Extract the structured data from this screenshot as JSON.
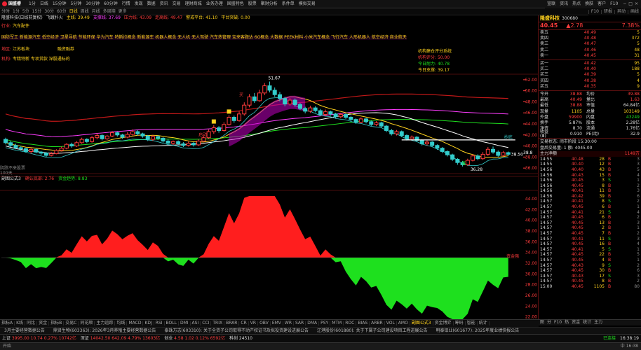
{
  "app": {
    "logo_label": "国盛睿",
    "menu": [
      "1分",
      "日线",
      "15分钟",
      "5分钟",
      "30分钟",
      "60分钟",
      "行情",
      "发现",
      "数据",
      "资讯",
      "交易",
      "理财商城",
      "业务办理",
      "国盛特色",
      "股票",
      "聚财分析",
      "条件单",
      "模拟交易"
    ],
    "right_buttons": [
      "宣联",
      "资讯",
      "热点",
      "换肤",
      "客户",
      "F10"
    ],
    "win_controls": [
      "−",
      "□",
      "×"
    ]
  },
  "periodbar": {
    "periods": [
      "分时",
      "1分",
      "5分",
      "15分",
      "30分",
      "60分",
      "日线",
      "周线",
      "月线",
      "多周期",
      "更多"
    ],
    "active_period": "日线",
    "right_tools": [
      "F10",
      "研报",
      "异动",
      "画线"
    ]
  },
  "main": {
    "stock_name": "隆盛科技",
    "legend_line1": [
      {
        "text": "隆盛科技(日线前复权)",
        "color": "#dddddd"
      },
      {
        "text": "飞蛾扑火",
        "color": "#dddddd"
      },
      {
        "text": "主线: 39.49",
        "color": "#ffd21e"
      },
      {
        "text": "支撑线: 37.69",
        "color": "#ff3cff"
      },
      {
        "text": "压力线: 43.09",
        "color": "#ff3c3c"
      },
      {
        "text": "走高线: 49.47",
        "color": "#ff3c3c"
      },
      {
        "text": "警戒平台: 41.10",
        "color": "#ffd21e"
      },
      {
        "text": "平台突破: 0.00",
        "color": "#ffd21e"
      }
    ],
    "concept_label": "行业:",
    "concept_value": "汽车配件",
    "concept_line": "国防军工 新能源汽车 低空经济 卫星导航 节能环保 华为汽车 特斯拉概念 新能源车 机器人概念 无人机 无人驾驶 汽车热管理 宝来客题达 6G概念 大数据 PEEK材料 小米汽车概念 飞行汽车 人形机器人 航空经济 商业航天",
    "region_label": "地区:",
    "region_value": "江苏板块",
    "financing_label": "融资融券",
    "main_biz_label": "机构:",
    "main_biz": "专精特新 专项贷款 深股通标的",
    "score_box": {
      "title": "机构建仓评分系统",
      "items": [
        {
          "label": "机构评分: ",
          "value": "50.00",
          "color": "#ff3c3c"
        },
        {
          "label": "今日耐力: ",
          "value": "40.78",
          "color": "#1ee01e"
        },
        {
          "label": "今日支撑: ",
          "value": "39.17",
          "color": "#ffd21e"
        }
      ]
    },
    "marks": {
      "high": "51.67",
      "low": "36.28",
      "last": "38.50",
      "right_tag": "38.8",
      "lbl_buy": "买",
      "lbl_start": "启动",
      "lbl_bottom": "底",
      "lbl_cb": "抄底"
    },
    "volume_caption": "阴跌不来股票",
    "volume_sub": "100天",
    "y_ticks_main": [
      "52.00",
      "50.00",
      "48.00",
      "46.00",
      "44.00",
      "42.00",
      "40.00",
      "38.00",
      "36.00"
    ],
    "y_ticks_sub": [
      "44.00",
      "42.00",
      "40.00",
      "38.00",
      "36.00",
      "34.00",
      "32.00",
      "30.00",
      "28.00",
      "26.00",
      "24.00",
      "22.00",
      "20.00"
    ],
    "date_ticks": [
      {
        "label": "2025年",
        "x": 2
      },
      {
        "label": "12",
        "x": 118
      },
      {
        "label": "2",
        "x": 286
      },
      {
        "label": "3",
        "x": 450
      },
      {
        "label": "4",
        "x": 690
      }
    ]
  },
  "sub": {
    "title": "副图公式3",
    "legend": [
      {
        "text": "确认底部: 2.76",
        "color": "#ff3c3c"
      },
      {
        "text": "资金趋势: 8.83",
        "color": "#1ee01e"
      }
    ],
    "peak_label": "资金强"
  },
  "chart_data": {
    "type": "candlestick",
    "title": "隆盛科技(日线前复权)",
    "ylim": [
      35,
      53
    ],
    "candles": [
      [
        41.2,
        40.6,
        41.5,
        40.3
      ],
      [
        40.6,
        40.1,
        40.9,
        39.8
      ],
      [
        40.1,
        39.7,
        40.4,
        39.4
      ],
      [
        39.7,
        39.5,
        40.0,
        39.2
      ],
      [
        39.5,
        39.0,
        39.7,
        38.8
      ],
      [
        39.0,
        39.4,
        39.6,
        38.6
      ],
      [
        39.4,
        38.9,
        39.5,
        38.7
      ],
      [
        38.9,
        38.7,
        39.1,
        38.4
      ],
      [
        38.7,
        38.3,
        38.9,
        38.0
      ],
      [
        38.3,
        38.6,
        38.9,
        38.1
      ],
      [
        38.6,
        39.2,
        39.4,
        38.5
      ],
      [
        39.2,
        39.6,
        39.9,
        39.0
      ],
      [
        39.6,
        40.3,
        40.5,
        39.4
      ],
      [
        40.3,
        40.0,
        40.6,
        39.7
      ],
      [
        40.0,
        40.6,
        40.9,
        39.8
      ],
      [
        40.6,
        41.2,
        41.5,
        40.4
      ],
      [
        41.2,
        40.8,
        41.4,
        40.5
      ],
      [
        40.8,
        41.5,
        41.8,
        40.6
      ],
      [
        41.5,
        41.9,
        42.3,
        41.2
      ],
      [
        41.9,
        41.3,
        42.1,
        41.0
      ],
      [
        41.3,
        41.8,
        42.0,
        41.1
      ],
      [
        41.8,
        42.4,
        42.7,
        41.6
      ],
      [
        42.4,
        42.0,
        42.6,
        41.7
      ],
      [
        42.0,
        41.6,
        42.2,
        41.3
      ],
      [
        41.6,
        42.1,
        42.5,
        41.4
      ],
      [
        42.1,
        42.6,
        43.0,
        41.9
      ],
      [
        42.6,
        42.2,
        42.9,
        41.9
      ],
      [
        42.2,
        41.8,
        42.4,
        41.5
      ],
      [
        41.8,
        41.2,
        42.0,
        40.9
      ],
      [
        41.2,
        41.7,
        42.0,
        40.9
      ],
      [
        41.7,
        41.4,
        41.9,
        41.1
      ],
      [
        41.4,
        40.9,
        41.6,
        40.6
      ],
      [
        40.9,
        40.5,
        41.2,
        40.2
      ],
      [
        40.5,
        40.8,
        41.0,
        40.2
      ],
      [
        40.8,
        40.4,
        41.0,
        40.1
      ],
      [
        40.4,
        40.1,
        40.7,
        39.8
      ],
      [
        40.1,
        40.5,
        40.8,
        39.9
      ],
      [
        40.5,
        40.2,
        40.7,
        39.9
      ],
      [
        40.2,
        40.9,
        41.2,
        40.0
      ],
      [
        40.9,
        41.5,
        41.8,
        40.7
      ],
      [
        41.5,
        42.6,
        43.0,
        41.3
      ],
      [
        42.6,
        43.3,
        43.8,
        42.2
      ],
      [
        43.3,
        42.8,
        43.6,
        42.4
      ],
      [
        42.8,
        43.9,
        44.3,
        42.6
      ],
      [
        43.9,
        45.2,
        45.6,
        43.7
      ],
      [
        45.2,
        44.6,
        45.5,
        44.2
      ],
      [
        44.6,
        45.8,
        46.3,
        44.4
      ],
      [
        45.8,
        47.4,
        47.9,
        45.5
      ],
      [
        47.4,
        48.9,
        49.4,
        47.0
      ],
      [
        48.9,
        48.2,
        49.6,
        47.8
      ],
      [
        48.2,
        49.6,
        50.2,
        48.0
      ],
      [
        49.6,
        50.9,
        51.4,
        49.2
      ],
      [
        50.9,
        50.1,
        51.67,
        49.7
      ],
      [
        50.1,
        49.3,
        50.6,
        48.9
      ],
      [
        49.3,
        48.6,
        49.8,
        48.1
      ],
      [
        48.6,
        47.6,
        48.9,
        47.2
      ],
      [
        47.6,
        48.3,
        48.7,
        47.3
      ],
      [
        48.3,
        47.5,
        48.6,
        47.1
      ],
      [
        47.5,
        46.8,
        47.8,
        46.5
      ],
      [
        46.8,
        46.3,
        47.1,
        45.9
      ],
      [
        46.3,
        46.9,
        47.3,
        46.0
      ],
      [
        46.9,
        46.4,
        47.2,
        46.1
      ],
      [
        46.4,
        45.7,
        46.7,
        45.4
      ],
      [
        45.7,
        46.2,
        46.6,
        45.4
      ],
      [
        46.2,
        45.8,
        46.4,
        45.5
      ],
      [
        45.8,
        45.3,
        46.0,
        45.0
      ],
      [
        45.3,
        45.7,
        46.0,
        45.0
      ],
      [
        45.7,
        45.2,
        45.9,
        44.9
      ],
      [
        45.2,
        44.8,
        45.5,
        44.5
      ],
      [
        44.8,
        44.3,
        45.0,
        44.0
      ],
      [
        44.3,
        44.9,
        45.2,
        44.1
      ],
      [
        44.9,
        44.4,
        45.1,
        44.1
      ],
      [
        44.4,
        43.9,
        44.6,
        43.6
      ],
      [
        43.9,
        44.2,
        44.5,
        43.6
      ],
      [
        44.2,
        43.6,
        44.4,
        43.3
      ],
      [
        43.6,
        42.8,
        43.8,
        42.5
      ],
      [
        42.8,
        42.2,
        43.1,
        41.9
      ],
      [
        42.2,
        42.6,
        42.9,
        41.9
      ],
      [
        42.6,
        41.9,
        42.8,
        41.6
      ],
      [
        41.9,
        41.3,
        42.1,
        41.0
      ],
      [
        41.3,
        41.6,
        41.9,
        41.0
      ],
      [
        41.6,
        41.0,
        41.8,
        40.7
      ],
      [
        41.0,
        40.4,
        41.2,
        40.1
      ],
      [
        40.4,
        40.7,
        41.0,
        40.1
      ],
      [
        40.7,
        40.1,
        40.9,
        39.8
      ],
      [
        40.1,
        39.6,
        40.3,
        39.3
      ],
      [
        39.6,
        39.0,
        39.8,
        38.7
      ],
      [
        39.0,
        38.4,
        39.2,
        38.1
      ],
      [
        38.4,
        37.6,
        38.6,
        37.3
      ],
      [
        37.6,
        37.0,
        37.8,
        36.6
      ],
      [
        37.0,
        36.6,
        37.3,
        36.28
      ],
      [
        36.6,
        37.4,
        37.7,
        36.4
      ],
      [
        37.4,
        38.2,
        38.5,
        37.2
      ],
      [
        38.2,
        37.7,
        38.5,
        37.4
      ],
      [
        37.7,
        38.5,
        38.9,
        37.5
      ],
      [
        38.5,
        39.4,
        39.8,
        38.2
      ],
      [
        39.4,
        38.9,
        39.9,
        38.6
      ],
      [
        38.9,
        38.3,
        39.2,
        38.0
      ],
      [
        38.3,
        38.8,
        39.1,
        38.0
      ],
      [
        38.8,
        38.5,
        39.0,
        38.2
      ]
    ],
    "series": [
      {
        "name": "主线",
        "values": []
      },
      {
        "name": "支撑线",
        "values": []
      },
      {
        "name": "压力线",
        "values": []
      }
    ]
  },
  "side": {
    "name": "隆盛科技",
    "code": "300680",
    "price": "40.45",
    "change": "▲2.78",
    "pct": "7.38%",
    "asks": [
      {
        "l": "卖五",
        "p": "40.49",
        "v": "5"
      },
      {
        "l": "卖四",
        "p": "40.48",
        "v": "372"
      },
      {
        "l": "卖三",
        "p": "40.47",
        "v": "5"
      },
      {
        "l": "卖二",
        "p": "40.46",
        "v": "48"
      },
      {
        "l": "卖一",
        "p": "40.45",
        "v": "31"
      }
    ],
    "bids": [
      {
        "l": "买一",
        "p": "40.42",
        "v": "95"
      },
      {
        "l": "买二",
        "p": "40.40",
        "v": "188"
      },
      {
        "l": "买三",
        "p": "40.39",
        "v": "5"
      },
      {
        "l": "买四",
        "p": "40.38",
        "v": "4"
      },
      {
        "l": "买五",
        "p": "40.35",
        "v": "9"
      }
    ],
    "stats": [
      {
        "k": "今开",
        "v": "38.88",
        "vc": "#ff3c3c",
        "k2": "均价",
        "v2": "39.88",
        "v2c": "#ff3c3c"
      },
      {
        "k": "最高",
        "v": "40.49",
        "vc": "#ff3c3c",
        "k2": "量比",
        "v2": "1.63",
        "v2c": "#ff3c3c"
      },
      {
        "k": "最低",
        "v": "38.88",
        "vc": "#ff3c3c",
        "k2": "市值",
        "v2": "64.84亿",
        "v2c": "#dddddd"
      },
      {
        "k": "现量",
        "v": "1105",
        "vc": "#ffd21e",
        "k2": "总量",
        "v2": "103149",
        "v2c": "#ffd21e"
      },
      {
        "k": "外盘",
        "v": "59900",
        "vc": "#ff3c3c",
        "k2": "内盘",
        "v2": "43249",
        "v2c": "#1ee01e"
      },
      {
        "k": "换手",
        "v": "5.87%",
        "vc": "#dddddd",
        "k2": "股本",
        "v2": "2.28亿",
        "v2c": "#dddddd"
      },
      {
        "k": "净资",
        "v": "8.70",
        "vc": "#dddddd",
        "k2": "流通",
        "v2": "1.76亿",
        "v2c": "#dddddd"
      },
      {
        "k": "收益(Ⅲ)",
        "v": "0.910",
        "vc": "#dddddd",
        "k2": "PE(动)",
        "v2": "32.9",
        "v2c": "#dddddd"
      }
    ],
    "trade_status": "交易状态: 闭市阶段 15:30:00",
    "after_volume": "盘后交易量: 1 额: 4045.00",
    "main_flow_label": "主力净额",
    "main_flow_value": "1149万",
    "ticks": [
      {
        "t": "14:55",
        "p": "40.48",
        "q": "28",
        "s": "B",
        "n": "3"
      },
      {
        "t": "14:55",
        "p": "40.40",
        "q": "12",
        "s": "B",
        "n": "3"
      },
      {
        "t": "14:56",
        "p": "40.40",
        "q": "43",
        "s": "B",
        "n": "5"
      },
      {
        "t": "14:56",
        "p": "40.43",
        "q": "15",
        "s": "B",
        "n": "4"
      },
      {
        "t": "14:56",
        "p": "40.45",
        "q": "3",
        "s": "S",
        "n": "1"
      },
      {
        "t": "14:56",
        "p": "40.45",
        "q": "8",
        "s": "B",
        "n": "2"
      },
      {
        "t": "14:56",
        "p": "40.41",
        "q": "11",
        "s": "B",
        "n": "3"
      },
      {
        "t": "14:56",
        "p": "40.42",
        "q": "39",
        "s": "B",
        "n": "6"
      },
      {
        "t": "14:57",
        "p": "40.41",
        "q": "8",
        "s": "S",
        "n": "2"
      },
      {
        "t": "14:57",
        "p": "40.45",
        "q": "6",
        "s": "B",
        "n": "1"
      },
      {
        "t": "14:57",
        "p": "40.41",
        "q": "21",
        "s": "S",
        "n": "4"
      },
      {
        "t": "14:57",
        "p": "40.45",
        "q": "6",
        "s": "B",
        "n": "2"
      },
      {
        "t": "14:57",
        "p": "40.45",
        "q": "13",
        "s": "B",
        "n": "3"
      },
      {
        "t": "14:57",
        "p": "40.45",
        "q": "2",
        "s": "B",
        "n": "1"
      },
      {
        "t": "14:57",
        "p": "40.45",
        "q": "7",
        "s": "B",
        "n": "2"
      },
      {
        "t": "14:57",
        "p": "40.41",
        "q": "11",
        "s": "S",
        "n": "3"
      },
      {
        "t": "14:57",
        "p": "40.45",
        "q": "16",
        "s": "B",
        "n": "4"
      },
      {
        "t": "14:57",
        "p": "40.41",
        "q": "5",
        "s": "S",
        "n": "1"
      },
      {
        "t": "14:57",
        "p": "40.45",
        "q": "22",
        "s": "B",
        "n": "5"
      },
      {
        "t": "14:57",
        "p": "40.45",
        "q": "4",
        "s": "B",
        "n": "1"
      },
      {
        "t": "14:57",
        "p": "40.43",
        "q": "9",
        "s": "S",
        "n": "2"
      },
      {
        "t": "14:57",
        "p": "40.45",
        "q": "30",
        "s": "B",
        "n": "6"
      },
      {
        "t": "14:57",
        "p": "40.43",
        "q": "17",
        "s": "S",
        "n": "3"
      },
      {
        "t": "14:57",
        "p": "40.45",
        "q": "8",
        "s": "B",
        "n": "2"
      },
      {
        "t": "15:00",
        "p": "40.45",
        "q": "1105",
        "s": "B",
        "n": "80"
      }
    ],
    "tabs": [
      "图",
      "分",
      "F10",
      "热",
      "资金",
      "统计",
      "主力"
    ]
  },
  "bottom_tabs": {
    "items": [
      "指标A",
      "K线",
      "同比",
      "资金",
      "指标B",
      "交易C",
      "同花顺",
      "主力追踪",
      "均线",
      "MACD",
      "KDJ",
      "RSI",
      "BOLL",
      "DMI",
      "ASI",
      "CCI",
      "TRIX",
      "BRAR",
      "CR",
      "VR",
      "OBV",
      "EMV",
      "WR",
      "SAR",
      "DMA",
      "PSY",
      "MTM",
      "ROC",
      "BIAS",
      "ARBR",
      "VOL",
      "AMO",
      "副图公式3",
      "资金博弈",
      "筹码",
      "智能",
      "统计"
    ],
    "active": "副图公式3"
  },
  "news": [
    "3月主要经营数据公告",
    "鼎贤生物(603363): 2026年3月养殖主要经营数据公告",
    "泰珠万志(603310): 关于全资子公司取得不动产权证书及拟投资建设进展公告",
    "辽港股份(601880): 关于下属子公司建设项目工程进展公告",
    "明泰铝业(601677): 2025年度业绩快报公告"
  ],
  "status": {
    "indexes": [
      {
        "name": "上证",
        "val": "3995.00",
        "chg": "10.74",
        "pct": "0.27%",
        "amt": "10742亿",
        "c": "#ff3c3c"
      },
      {
        "name": "深证",
        "val": "14042.50",
        "chg": "642.09",
        "pct": "4.79%",
        "amt": "13603亿",
        "c": "#ff3c3c"
      },
      {
        "name": "创业",
        "val": "4.58",
        "chg": "1.02",
        "pct": "0.12%",
        "amt": "6592亿",
        "c": "#ff3c3c"
      },
      {
        "name": "科创",
        "val": "24510",
        "chg": "",
        "pct": "",
        "amt": "",
        "c": "#dddddd"
      }
    ],
    "connected": "已连接",
    "clock": "16:38:19"
  },
  "tray": {
    "left": "开始",
    "right": "中 16:38"
  }
}
